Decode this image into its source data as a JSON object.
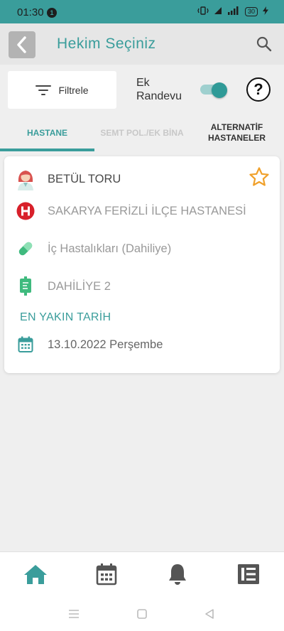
{
  "status_bar": {
    "time": "01:30",
    "notification_count": "1",
    "battery": "30"
  },
  "header": {
    "title": "Hekim Seçiniz"
  },
  "filter_bar": {
    "filter_label": "Filtrele",
    "ek_randevu_label": "Ek Randevu",
    "ek_randevu_enabled": true,
    "help_label": "?"
  },
  "tabs": [
    {
      "label": "HASTANE",
      "active": true
    },
    {
      "label": "SEMT POL./EK BİNA",
      "active": false,
      "disabled": true
    },
    {
      "label": "ALTERNATİF HASTANELER",
      "active": false
    }
  ],
  "doctor_card": {
    "doctor_name": "BETÜL TORU",
    "hospital": "SAKARYA FERİZLİ İLÇE HASTANESİ",
    "department": "İç Hastalıkları (Dahiliye)",
    "clinic": "DAHİLİYE 2",
    "nearest_label": "EN YAKIN TARİH",
    "nearest_date": "13.10.2022 Perşembe",
    "favorite": false
  },
  "colors": {
    "primary": "#3a9d9b",
    "star": "#f0a02a",
    "hospital_red": "#d8202a",
    "icon_green": "#3fba7e"
  },
  "bottom_nav": [
    "home-icon",
    "calendar-icon",
    "bell-icon",
    "list-icon"
  ]
}
